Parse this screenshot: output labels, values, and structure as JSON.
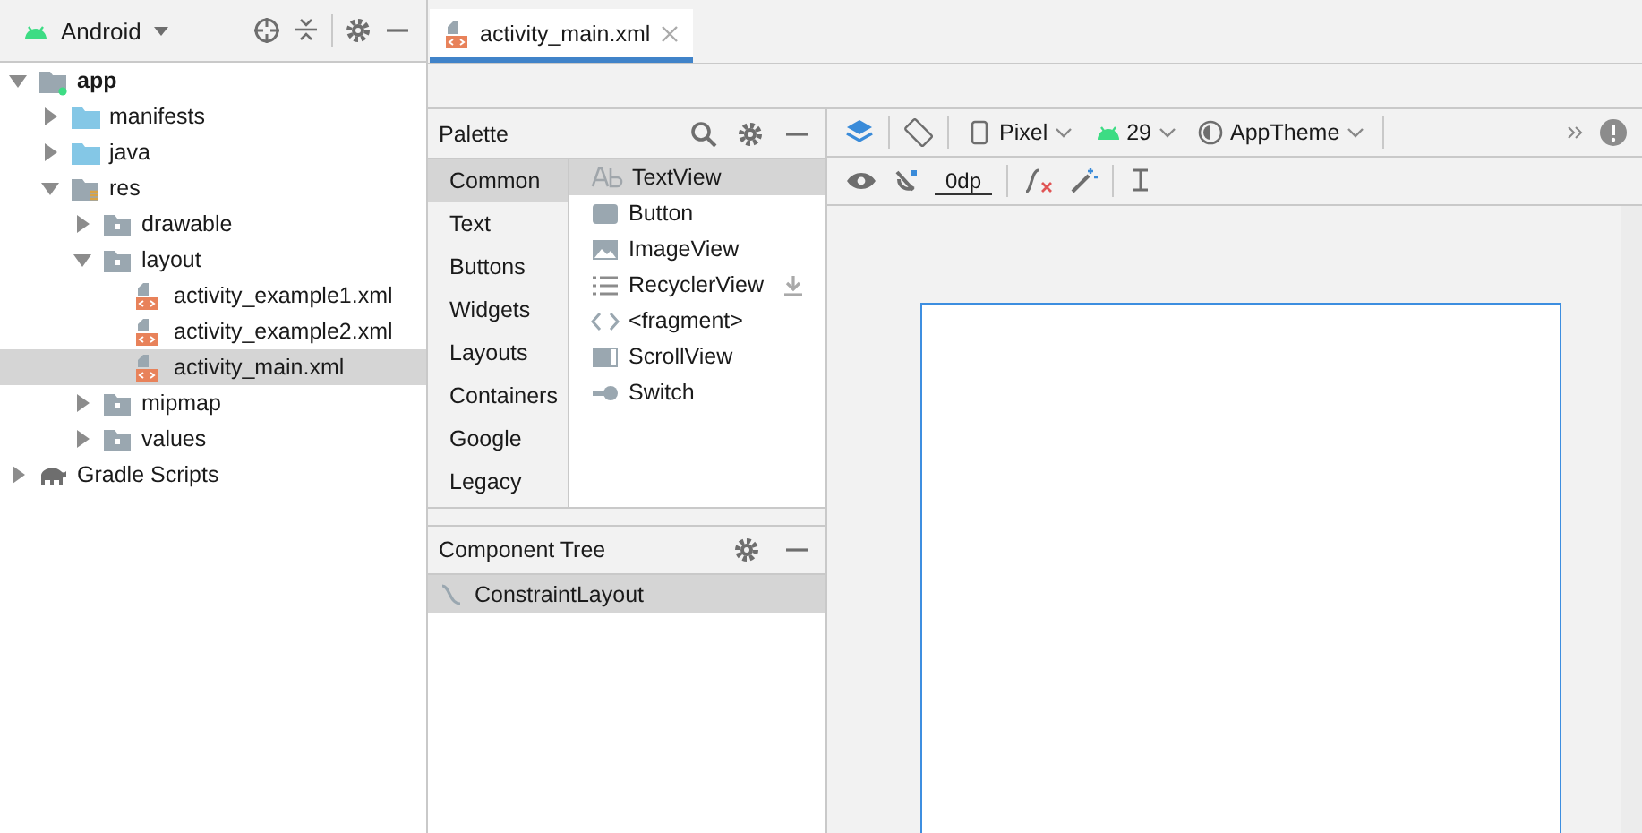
{
  "project_panel": {
    "view": "Android",
    "tree": [
      {
        "label": "app",
        "kind": "module",
        "expanded": true,
        "selected": false,
        "children": [
          {
            "label": "manifests",
            "kind": "source",
            "expanded": false,
            "selected": false
          },
          {
            "label": "java",
            "kind": "source",
            "expanded": false,
            "selected": false
          },
          {
            "label": "res",
            "kind": "res",
            "expanded": true,
            "selected": false,
            "children": [
              {
                "label": "drawable",
                "kind": "folder",
                "expanded": false,
                "selected": false
              },
              {
                "label": "layout",
                "kind": "folder",
                "expanded": true,
                "selected": false,
                "children": [
                  {
                    "label": "activity_example1.xml",
                    "kind": "file",
                    "selected": false
                  },
                  {
                    "label": "activity_example2.xml",
                    "kind": "file",
                    "selected": false
                  },
                  {
                    "label": "activity_main.xml",
                    "kind": "file",
                    "selected": true
                  }
                ]
              },
              {
                "label": "mipmap",
                "kind": "folder",
                "expanded": false,
                "selected": false
              },
              {
                "label": "values",
                "kind": "folder",
                "expanded": false,
                "selected": false
              }
            ]
          }
        ]
      },
      {
        "label": "Gradle Scripts",
        "kind": "gradle",
        "expanded": false,
        "selected": false
      }
    ]
  },
  "editor_tabs": [
    {
      "label": "activity_main.xml",
      "selected": true
    }
  ],
  "palette": {
    "title": "Palette",
    "categories": [
      {
        "label": "Common",
        "selected": true
      },
      {
        "label": "Text",
        "selected": false
      },
      {
        "label": "Buttons",
        "selected": false
      },
      {
        "label": "Widgets",
        "selected": false
      },
      {
        "label": "Layouts",
        "selected": false
      },
      {
        "label": "Containers",
        "selected": false
      },
      {
        "label": "Google",
        "selected": false
      },
      {
        "label": "Legacy",
        "selected": false
      }
    ],
    "items": [
      {
        "label": "TextView",
        "kind": "text",
        "selected": true,
        "downloadable": false
      },
      {
        "label": "Button",
        "kind": "button",
        "selected": false,
        "downloadable": false
      },
      {
        "label": "ImageView",
        "kind": "image",
        "selected": false,
        "downloadable": false
      },
      {
        "label": "RecyclerView",
        "kind": "list",
        "selected": false,
        "downloadable": true
      },
      {
        "label": "<fragment>",
        "kind": "fragment",
        "selected": false,
        "downloadable": false
      },
      {
        "label": "ScrollView",
        "kind": "scroll",
        "selected": false,
        "downloadable": false
      },
      {
        "label": "Switch",
        "kind": "switch",
        "selected": false,
        "downloadable": false
      }
    ]
  },
  "component_tree": {
    "title": "Component Tree",
    "items": [
      {
        "label": "ConstraintLayout",
        "selected": true
      }
    ]
  },
  "design_toolbar": {
    "device": "Pixel",
    "api": "29",
    "theme": "AppTheme",
    "margin": "0dp"
  }
}
